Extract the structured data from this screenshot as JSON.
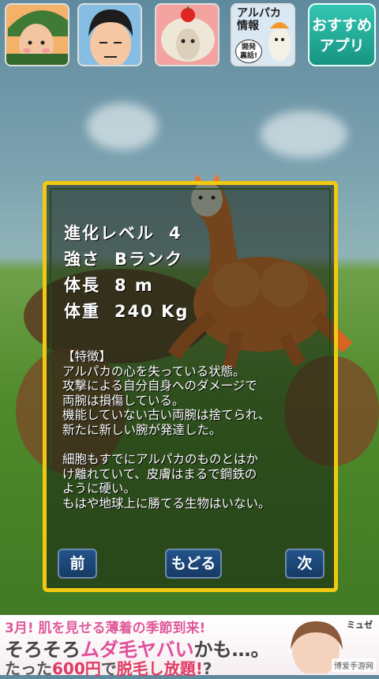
{
  "top_bar": {
    "tiles": [
      {
        "name": "elf-face-app-icon"
      },
      {
        "name": "man-face-app-icon"
      },
      {
        "name": "sheep-app-icon"
      },
      {
        "name": "alpaca-info-icon",
        "text_line1": "アルパカ",
        "text_line2": "情報",
        "badge": "開発\n裏話!"
      }
    ],
    "promo_label_line1": "おすすめ",
    "promo_label_line2": "アプリ"
  },
  "stats": {
    "level_label": "進化レベル",
    "level_value": "4",
    "strength_label": "強さ",
    "strength_value": "Bランク",
    "height_label": "体長",
    "height_value": "8 m",
    "weight_label": "体重",
    "weight_value": "240 Kg"
  },
  "description": {
    "heading": "【特徴】",
    "text": "アルパカの心を失っている状態。\n攻撃による自分自身へのダメージで\n両腕は損傷している。\n機能していない古い両腕は捨てられ、\n新たに新しい腕が発達した。\n\n細胞もすでにアルパカのものとはか\nけ離れていて、皮膚はまるで鋼鉄の\nように硬い。\nもはや地球上に勝てる生物はいない。"
  },
  "buttons": {
    "prev": "前",
    "back": "もどる",
    "next": "次"
  },
  "ad": {
    "line1": "3月! 肌を見せる薄着の季節到来!",
    "line2a": "そろそろ",
    "line2b": "ムダ毛ヤバい",
    "line2c": "かも…。",
    "line3a": "たった",
    "line3b": "600円",
    "line3c": "で",
    "line3d": "脱毛し放題!",
    "line3e": "?",
    "brand": "ミュゼ",
    "watermark": "博爱手游网"
  },
  "colors": {
    "panel_border": "#f2c912",
    "button": "#1d4777",
    "promo": "#1fae99"
  }
}
